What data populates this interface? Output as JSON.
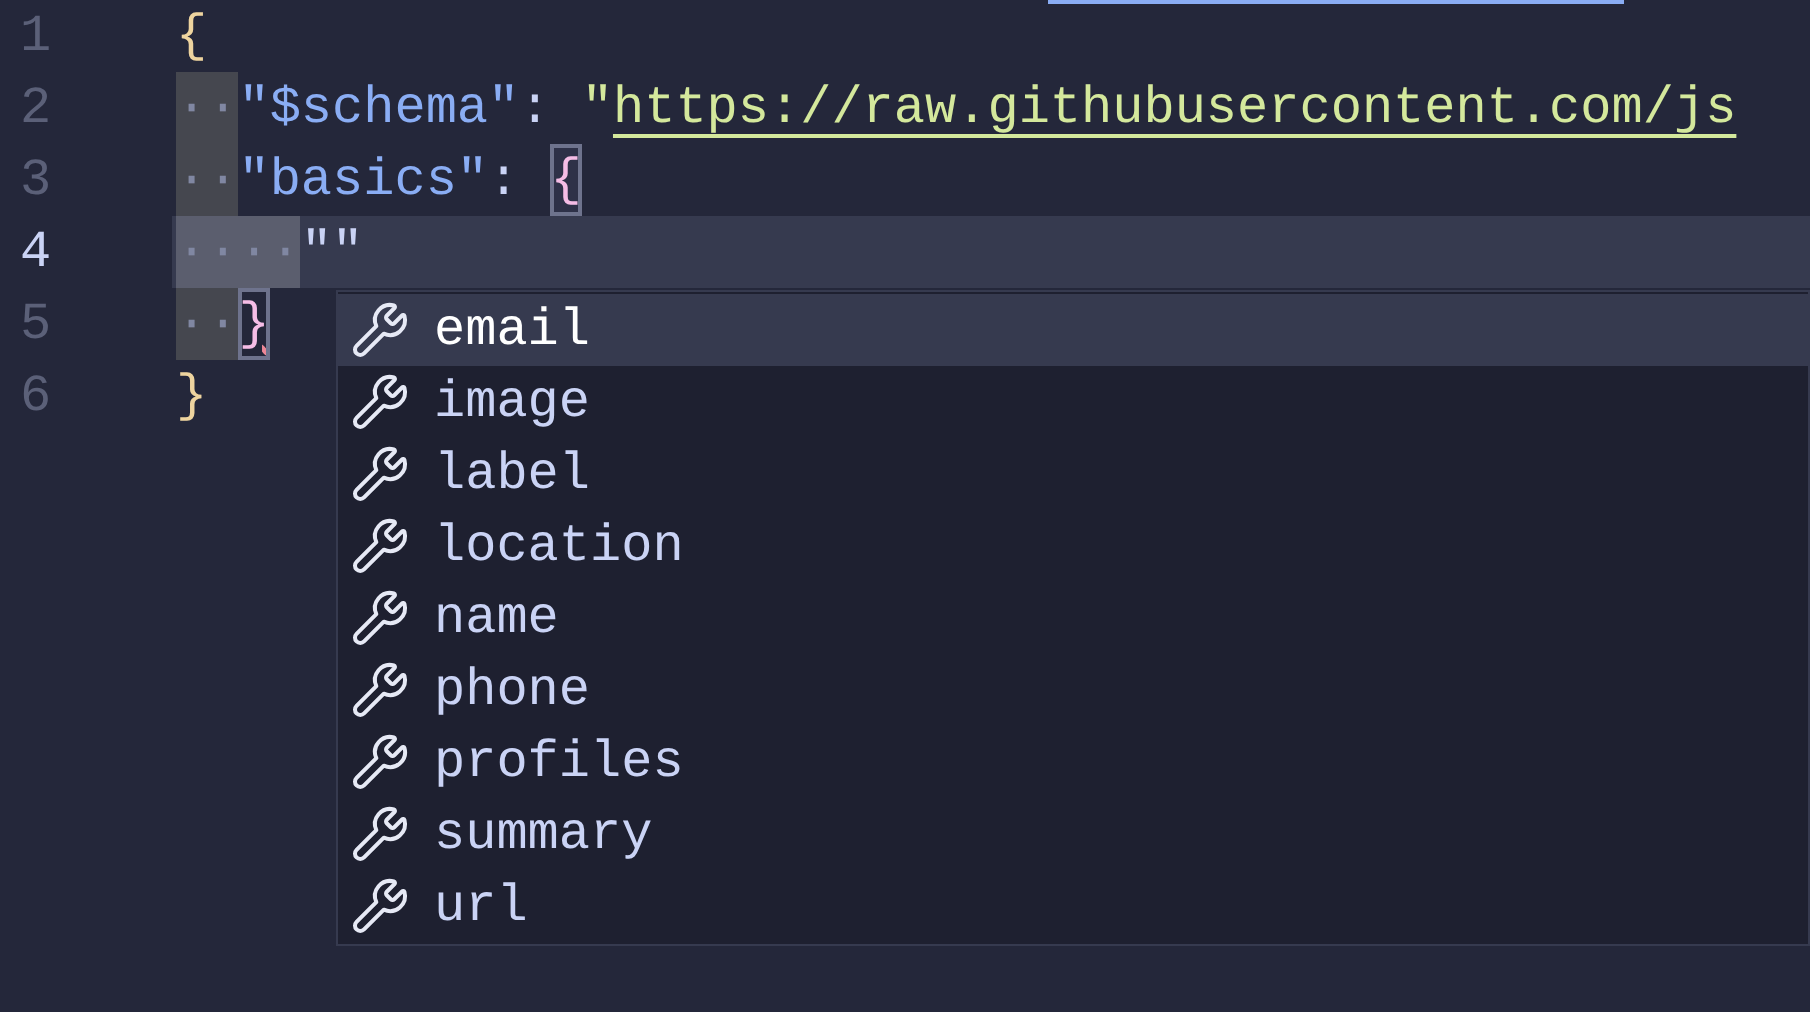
{
  "editor": {
    "lines": [
      {
        "number": "1",
        "active": false,
        "tokens": [
          {
            "kind": "brace",
            "text": "{"
          }
        ]
      },
      {
        "number": "2",
        "active": false,
        "tokens": [
          {
            "kind": "ws",
            "text": "··"
          },
          {
            "kind": "key",
            "text": "\"$schema\""
          },
          {
            "kind": "punct",
            "text": ": "
          },
          {
            "kind": "string",
            "text": "\""
          },
          {
            "kind": "link",
            "text": "https://raw.githubusercontent.com/js"
          }
        ]
      },
      {
        "number": "3",
        "active": false,
        "tokens": [
          {
            "kind": "ws",
            "text": "··"
          },
          {
            "kind": "key",
            "text": "\"basics\""
          },
          {
            "kind": "punct",
            "text": ": "
          },
          {
            "kind": "match",
            "text": "{"
          }
        ]
      },
      {
        "number": "4",
        "active": true,
        "tokens": [
          {
            "kind": "ws",
            "text": "··"
          },
          {
            "kind": "ws",
            "text": "··"
          },
          {
            "kind": "quote",
            "text": "\"\""
          }
        ]
      },
      {
        "number": "5",
        "active": false,
        "tokens": [
          {
            "kind": "ws",
            "text": "··"
          },
          {
            "kind": "error",
            "text": "}"
          }
        ]
      },
      {
        "number": "6",
        "active": false,
        "tokens": [
          {
            "kind": "brace",
            "text": "}"
          }
        ]
      }
    ]
  },
  "suggestions": [
    {
      "label": "email",
      "selected": true
    },
    {
      "label": "image",
      "selected": false
    },
    {
      "label": "label",
      "selected": false
    },
    {
      "label": "location",
      "selected": false
    },
    {
      "label": "name",
      "selected": false
    },
    {
      "label": "phone",
      "selected": false
    },
    {
      "label": "profiles",
      "selected": false
    },
    {
      "label": "summary",
      "selected": false
    },
    {
      "label": "url",
      "selected": false
    }
  ]
}
